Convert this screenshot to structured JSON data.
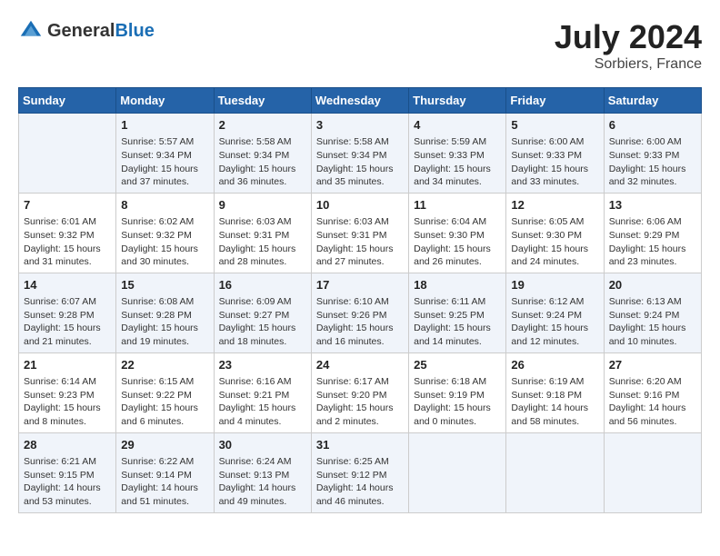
{
  "header": {
    "logo_general": "General",
    "logo_blue": "Blue",
    "title": "July 2024",
    "location": "Sorbiers, France"
  },
  "calendar": {
    "days_of_week": [
      "Sunday",
      "Monday",
      "Tuesday",
      "Wednesday",
      "Thursday",
      "Friday",
      "Saturday"
    ],
    "weeks": [
      [
        {
          "day": "",
          "info": ""
        },
        {
          "day": "1",
          "info": "Sunrise: 5:57 AM\nSunset: 9:34 PM\nDaylight: 15 hours\nand 37 minutes."
        },
        {
          "day": "2",
          "info": "Sunrise: 5:58 AM\nSunset: 9:34 PM\nDaylight: 15 hours\nand 36 minutes."
        },
        {
          "day": "3",
          "info": "Sunrise: 5:58 AM\nSunset: 9:34 PM\nDaylight: 15 hours\nand 35 minutes."
        },
        {
          "day": "4",
          "info": "Sunrise: 5:59 AM\nSunset: 9:33 PM\nDaylight: 15 hours\nand 34 minutes."
        },
        {
          "day": "5",
          "info": "Sunrise: 6:00 AM\nSunset: 9:33 PM\nDaylight: 15 hours\nand 33 minutes."
        },
        {
          "day": "6",
          "info": "Sunrise: 6:00 AM\nSunset: 9:33 PM\nDaylight: 15 hours\nand 32 minutes."
        }
      ],
      [
        {
          "day": "7",
          "info": "Sunrise: 6:01 AM\nSunset: 9:32 PM\nDaylight: 15 hours\nand 31 minutes."
        },
        {
          "day": "8",
          "info": "Sunrise: 6:02 AM\nSunset: 9:32 PM\nDaylight: 15 hours\nand 30 minutes."
        },
        {
          "day": "9",
          "info": "Sunrise: 6:03 AM\nSunset: 9:31 PM\nDaylight: 15 hours\nand 28 minutes."
        },
        {
          "day": "10",
          "info": "Sunrise: 6:03 AM\nSunset: 9:31 PM\nDaylight: 15 hours\nand 27 minutes."
        },
        {
          "day": "11",
          "info": "Sunrise: 6:04 AM\nSunset: 9:30 PM\nDaylight: 15 hours\nand 26 minutes."
        },
        {
          "day": "12",
          "info": "Sunrise: 6:05 AM\nSunset: 9:30 PM\nDaylight: 15 hours\nand 24 minutes."
        },
        {
          "day": "13",
          "info": "Sunrise: 6:06 AM\nSunset: 9:29 PM\nDaylight: 15 hours\nand 23 minutes."
        }
      ],
      [
        {
          "day": "14",
          "info": "Sunrise: 6:07 AM\nSunset: 9:28 PM\nDaylight: 15 hours\nand 21 minutes."
        },
        {
          "day": "15",
          "info": "Sunrise: 6:08 AM\nSunset: 9:28 PM\nDaylight: 15 hours\nand 19 minutes."
        },
        {
          "day": "16",
          "info": "Sunrise: 6:09 AM\nSunset: 9:27 PM\nDaylight: 15 hours\nand 18 minutes."
        },
        {
          "day": "17",
          "info": "Sunrise: 6:10 AM\nSunset: 9:26 PM\nDaylight: 15 hours\nand 16 minutes."
        },
        {
          "day": "18",
          "info": "Sunrise: 6:11 AM\nSunset: 9:25 PM\nDaylight: 15 hours\nand 14 minutes."
        },
        {
          "day": "19",
          "info": "Sunrise: 6:12 AM\nSunset: 9:24 PM\nDaylight: 15 hours\nand 12 minutes."
        },
        {
          "day": "20",
          "info": "Sunrise: 6:13 AM\nSunset: 9:24 PM\nDaylight: 15 hours\nand 10 minutes."
        }
      ],
      [
        {
          "day": "21",
          "info": "Sunrise: 6:14 AM\nSunset: 9:23 PM\nDaylight: 15 hours\nand 8 minutes."
        },
        {
          "day": "22",
          "info": "Sunrise: 6:15 AM\nSunset: 9:22 PM\nDaylight: 15 hours\nand 6 minutes."
        },
        {
          "day": "23",
          "info": "Sunrise: 6:16 AM\nSunset: 9:21 PM\nDaylight: 15 hours\nand 4 minutes."
        },
        {
          "day": "24",
          "info": "Sunrise: 6:17 AM\nSunset: 9:20 PM\nDaylight: 15 hours\nand 2 minutes."
        },
        {
          "day": "25",
          "info": "Sunrise: 6:18 AM\nSunset: 9:19 PM\nDaylight: 15 hours\nand 0 minutes."
        },
        {
          "day": "26",
          "info": "Sunrise: 6:19 AM\nSunset: 9:18 PM\nDaylight: 14 hours\nand 58 minutes."
        },
        {
          "day": "27",
          "info": "Sunrise: 6:20 AM\nSunset: 9:16 PM\nDaylight: 14 hours\nand 56 minutes."
        }
      ],
      [
        {
          "day": "28",
          "info": "Sunrise: 6:21 AM\nSunset: 9:15 PM\nDaylight: 14 hours\nand 53 minutes."
        },
        {
          "day": "29",
          "info": "Sunrise: 6:22 AM\nSunset: 9:14 PM\nDaylight: 14 hours\nand 51 minutes."
        },
        {
          "day": "30",
          "info": "Sunrise: 6:24 AM\nSunset: 9:13 PM\nDaylight: 14 hours\nand 49 minutes."
        },
        {
          "day": "31",
          "info": "Sunrise: 6:25 AM\nSunset: 9:12 PM\nDaylight: 14 hours\nand 46 minutes."
        },
        {
          "day": "",
          "info": ""
        },
        {
          "day": "",
          "info": ""
        },
        {
          "day": "",
          "info": ""
        }
      ]
    ]
  }
}
